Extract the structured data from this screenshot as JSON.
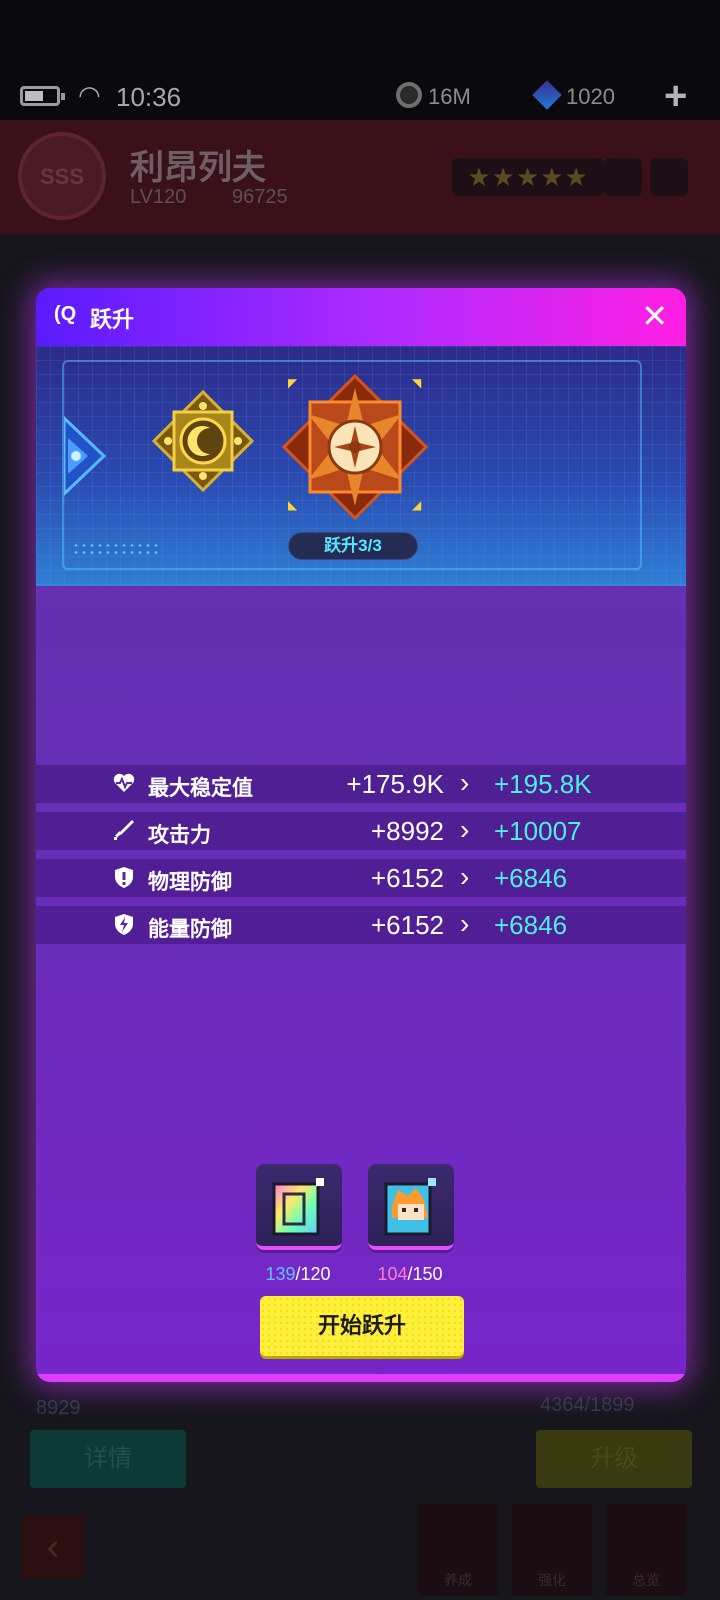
{
  "status_bar": {
    "time": "10:36",
    "coins": "16M",
    "gems": "1020",
    "add_label": "+"
  },
  "character": {
    "name": "利昂列夫",
    "level": "LV120",
    "power": "96725",
    "rank": "SSS",
    "stars": 5
  },
  "background_screen": {
    "energy": "8929",
    "exp": "4364/1899",
    "details_label": "详情",
    "upgrade_label": "升级",
    "tabs": [
      "养成",
      "强化",
      "总览"
    ]
  },
  "modal": {
    "title": "跃升",
    "close_label": "✕",
    "stage_label": "跃升3/3",
    "stats": [
      {
        "name": "最大稳定值",
        "icon": "heart-pulse-icon",
        "old": "+175.9K",
        "new": "+195.8K"
      },
      {
        "name": "攻击力",
        "icon": "sword-icon",
        "old": "+8992",
        "new": "+10007"
      },
      {
        "name": "物理防御",
        "icon": "shield-exclaim-icon",
        "old": "+6152",
        "new": "+6846"
      },
      {
        "name": "能量防御",
        "icon": "shield-bolt-icon",
        "old": "+6152",
        "new": "+6846"
      }
    ],
    "materials": [
      {
        "icon": "rainbow-chip-icon",
        "have": "139",
        "need": "/120"
      },
      {
        "icon": "character-shard-icon",
        "have": "104",
        "need": "/150"
      }
    ],
    "start_label": "开始跃升"
  },
  "colors": {
    "accent_cyan": "#4cf0e2",
    "header_gradient_start": "#5a1bff",
    "header_gradient_end": "#ff1ee3",
    "button_yellow": "#fff13a"
  }
}
